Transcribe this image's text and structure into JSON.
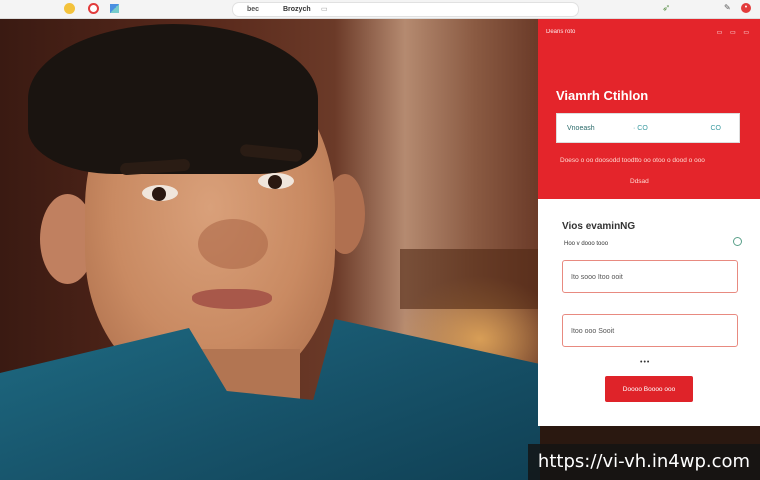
{
  "browser": {
    "url_part1": "bec",
    "url_part2": "Brozych",
    "url_part3": "▭"
  },
  "header": {
    "small_label": "Deans roto",
    "icons": "▭ ▭ ▭",
    "title": "Viamrh Ctihlon",
    "search_text": "Vnoeash",
    "search_mid": "· CO",
    "search_end": "CO",
    "line1": "Doeso o oo doosodd toodtto oo otoo o dood o ooo",
    "line2": "Ddsad"
  },
  "form": {
    "title": "Vios evaminNG",
    "subtitle": "Hoo v dooo tooo",
    "field1_label": "Ito sooo Itoo ooit",
    "field2_label": "Itoo ooo Sooit",
    "dots": "•••",
    "submit_label": "Doooo Boooo ooo"
  },
  "watermark": "https://vi-vh.in4wp.com",
  "colors": {
    "brand_red": "#e4252b",
    "field_border": "#e88a80",
    "radio_accent": "#5aa08a"
  }
}
